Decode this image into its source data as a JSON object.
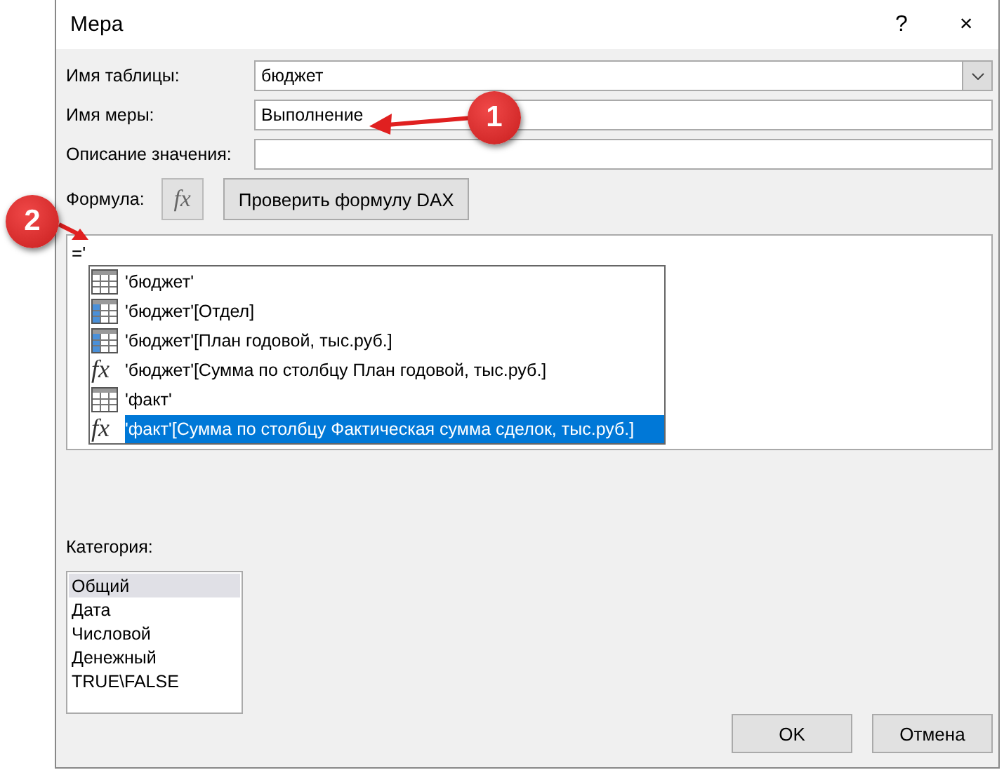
{
  "window": {
    "title": "Мера",
    "help": "?",
    "close": "×"
  },
  "fields": {
    "table_name": {
      "label": "Имя таблицы:",
      "value": "бюджет"
    },
    "measure_name": {
      "label": "Имя меры:",
      "value": "Выполнение"
    },
    "description": {
      "label": "Описание значения:"
    }
  },
  "formula": {
    "label": "Формула:",
    "fx": "fx",
    "check_button": "Проверить формулу DAX",
    "text": "='"
  },
  "autocomplete": [
    {
      "kind": "table",
      "text": "'бюджет'",
      "selected": false
    },
    {
      "kind": "column",
      "text": "'бюджет'[Отдел]",
      "selected": false
    },
    {
      "kind": "column",
      "text": "'бюджет'[План годовой, тыс.руб.]",
      "selected": false
    },
    {
      "kind": "measure",
      "icon": "fx",
      "text": "'бюджет'[Сумма по столбцу План годовой, тыс.руб.]",
      "selected": false
    },
    {
      "kind": "table",
      "text": "'факт'",
      "selected": false
    },
    {
      "kind": "measure",
      "icon": "fx",
      "text": "'факт'[Сумма по столбцу Фактическая сумма сделок, тыс.руб.]",
      "selected": true
    }
  ],
  "category": {
    "label": "Категория:",
    "items": [
      {
        "text": "Общий",
        "selected": true
      },
      {
        "text": "Дата",
        "selected": false
      },
      {
        "text": "Числовой",
        "selected": false
      },
      {
        "text": "Денежный",
        "selected": false
      },
      {
        "text": "TRUE\\FALSE",
        "selected": false
      }
    ]
  },
  "buttons": [
    "OK",
    "Отмена"
  ],
  "callouts": [
    "1",
    "2"
  ]
}
